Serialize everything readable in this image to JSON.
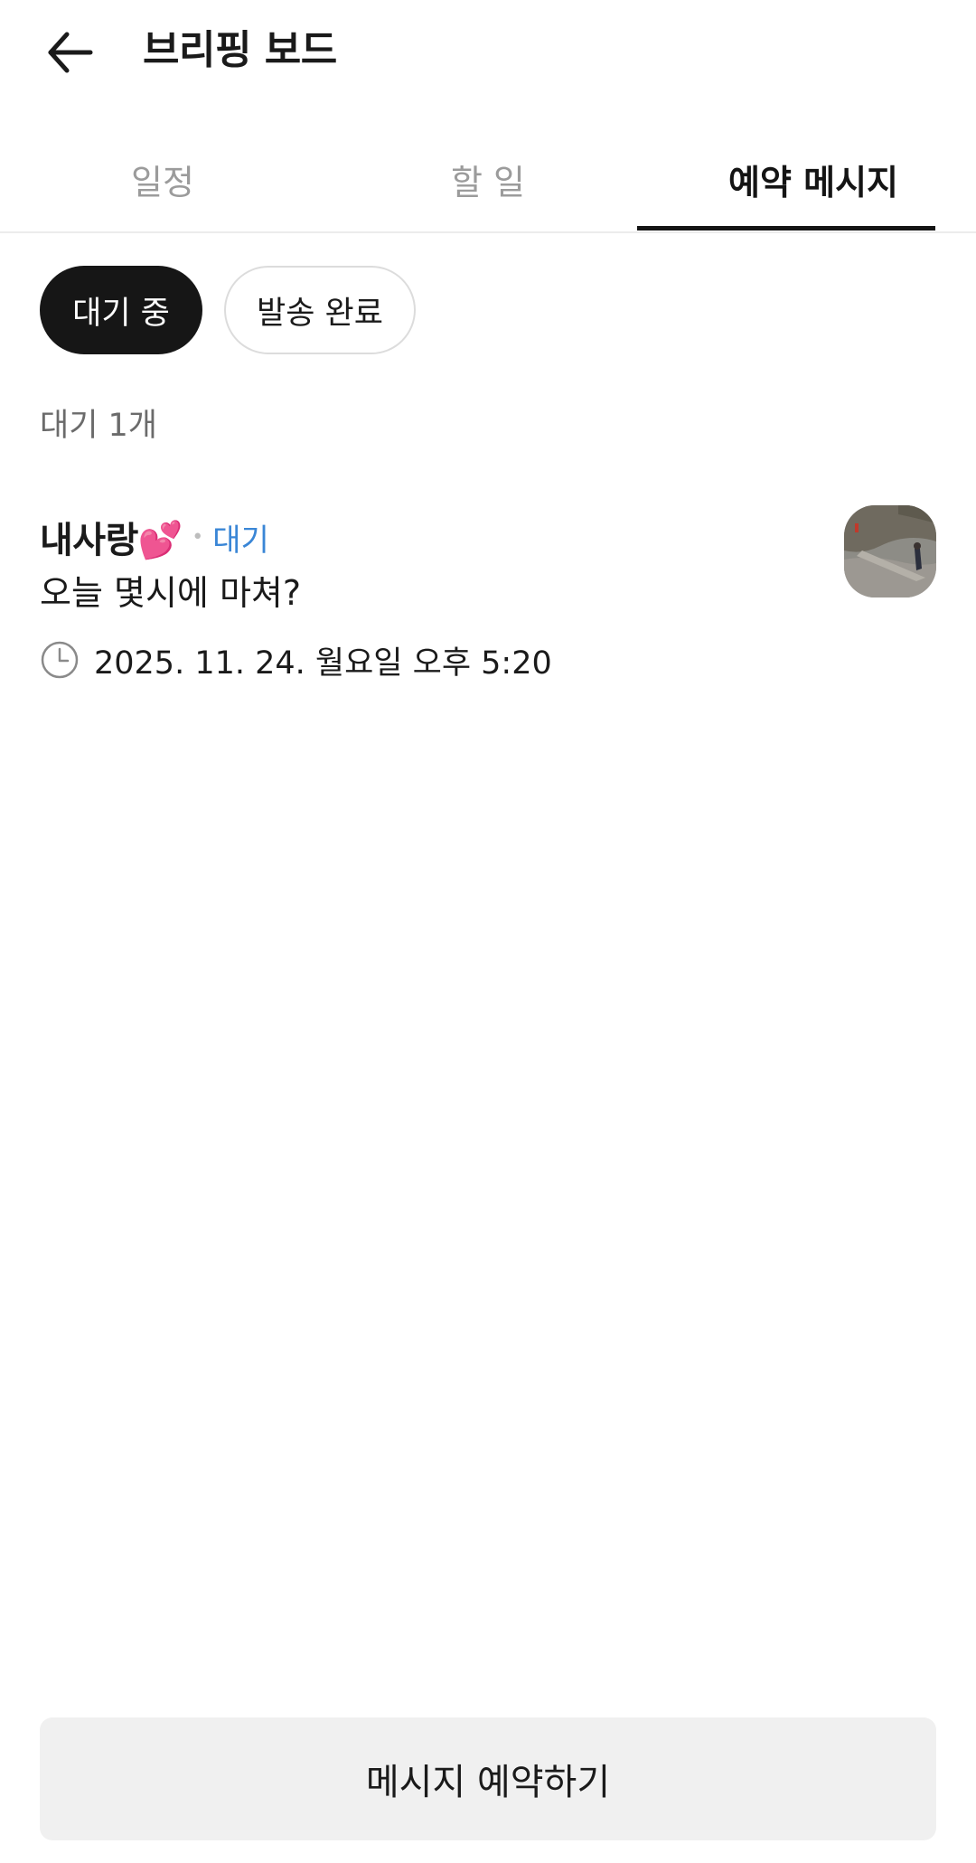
{
  "header": {
    "title": "브리핑 보드",
    "back_icon": "arrow-left-icon"
  },
  "tabs": [
    {
      "label": "일정",
      "active": false
    },
    {
      "label": "할 일",
      "active": false
    },
    {
      "label": "예약 메시지",
      "active": true
    }
  ],
  "filters": {
    "pending_label": "대기 중",
    "sent_label": "발송 완료",
    "selected": "대기 중"
  },
  "count_label": "대기 1개",
  "messages": [
    {
      "recipient": "내사랑💕",
      "status": "대기",
      "text": "오늘 몇시에 마쳐?",
      "scheduled_time": "2025. 11. 24. 월요일 오후 5:20",
      "time_icon": "clock-icon",
      "thumbnail": "profile-photo"
    }
  ],
  "cta": {
    "label": "메시지 예약하기"
  },
  "colors": {
    "accent_blue": "#3a86d6",
    "selected_chip": "#161616",
    "cta_bg": "#f0f0f0"
  }
}
